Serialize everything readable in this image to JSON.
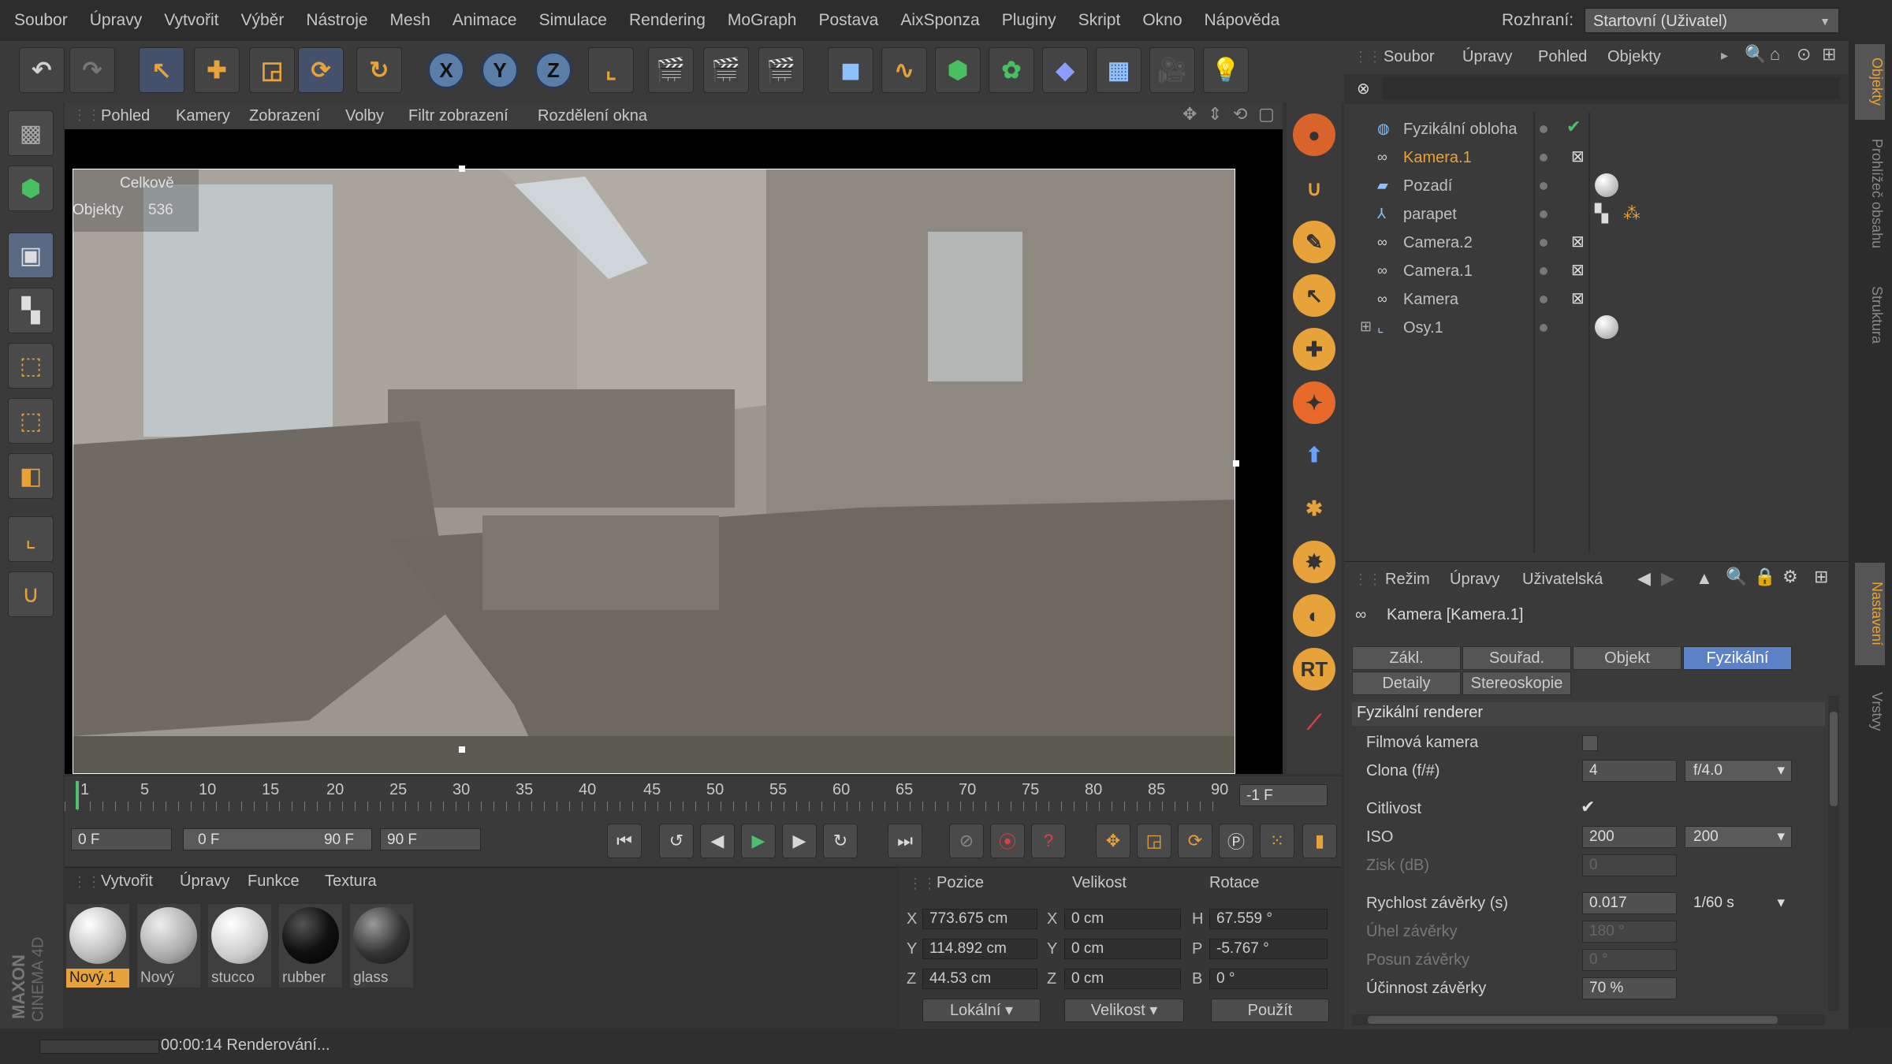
{
  "menubar": {
    "items": [
      "Soubor",
      "Úpravy",
      "Vytvořit",
      "Výběr",
      "Nástroje",
      "Mesh",
      "Animace",
      "Simulace",
      "Rendering",
      "MoGraph",
      "Postava",
      "AixSponza",
      "Pluginy",
      "Skript",
      "Okno",
      "Nápověda"
    ],
    "layout_label": "Rozhraní:",
    "layout_value": "Startovní (Uživatel)"
  },
  "toolbar": {
    "axis_x": "X",
    "axis_y": "Y",
    "axis_z": "Z"
  },
  "viewport": {
    "menu": [
      "Pohled",
      "Kamery",
      "Zobrazení",
      "Volby",
      "Filtr zobrazení",
      "Rozdělení okna"
    ],
    "hud_total": "Celkově",
    "hud_objects_label": "Objekty",
    "hud_objects_value": "536"
  },
  "rightbar": {
    "rt_label": "RT"
  },
  "timeline": {
    "ticks": [
      "1",
      "5",
      "10",
      "15",
      "20",
      "25",
      "30",
      "35",
      "40",
      "45",
      "50",
      "55",
      "60",
      "65",
      "70",
      "75",
      "80",
      "85",
      "90"
    ],
    "current_frame": "-1 F",
    "start_field": "0 F",
    "range_start": "0 F",
    "range_end": "90 F",
    "end_field": "90 F"
  },
  "materials": {
    "menu": [
      "Vytvořit",
      "Úpravy",
      "Funkce",
      "Textura"
    ],
    "items": [
      {
        "name": "Nový.1",
        "type": "white",
        "selected": true
      },
      {
        "name": "Nový",
        "type": "light",
        "selected": false
      },
      {
        "name": "stucco",
        "type": "white",
        "selected": false
      },
      {
        "name": "rubber",
        "type": "black",
        "selected": false
      },
      {
        "name": "glass",
        "type": "dark",
        "selected": false
      }
    ]
  },
  "coordinates": {
    "headers": {
      "position": "Pozice",
      "size": "Velikost",
      "rotation": "Rotace"
    },
    "rows": [
      {
        "pl": "X",
        "pv": "773.675 cm",
        "sl": "X",
        "sv": "0 cm",
        "rl": "H",
        "rv": "67.559 °"
      },
      {
        "pl": "Y",
        "pv": "114.892 cm",
        "sl": "Y",
        "sv": "0 cm",
        "rl": "P",
        "rv": "-5.767 °"
      },
      {
        "pl": "Z",
        "pv": "44.53 cm",
        "sl": "Z",
        "sv": "0 cm",
        "rl": "B",
        "rv": "0 °"
      }
    ],
    "mode_select": "Lokální",
    "size_select": "Velikost",
    "apply_button": "Použít"
  },
  "status": {
    "text": "00:00:14 Renderování..."
  },
  "objects": {
    "menu": [
      "Soubor",
      "Úpravy",
      "Pohled",
      "Objekty"
    ],
    "items": [
      {
        "name": "Fyzikální obloha",
        "icon": "sky-icon",
        "active": false
      },
      {
        "name": "Kamera.1",
        "icon": "camera-icon",
        "active": true
      },
      {
        "name": "Pozadí",
        "icon": "background-icon",
        "active": false
      },
      {
        "name": "parapet",
        "icon": "null-icon",
        "active": false
      },
      {
        "name": "Camera.2",
        "icon": "camera-icon",
        "active": false
      },
      {
        "name": "Camera.1",
        "icon": "camera-icon",
        "active": false
      },
      {
        "name": "Kamera",
        "icon": "camera-icon",
        "active": false
      },
      {
        "name": "Osy.1",
        "icon": "null-icon",
        "active": false
      }
    ]
  },
  "attributes": {
    "menu": [
      "Režim",
      "Úpravy",
      "Uživatelská"
    ],
    "object_title": "Kamera [Kamera.1]",
    "tabs_row1": [
      "Zákl.",
      "Souřad.",
      "Objekt",
      "Fyzikální"
    ],
    "tabs_row2": [
      "Detaily",
      "Stereoskopie"
    ],
    "active_tab": "Fyzikální",
    "section": "Fyzikální renderer",
    "props": {
      "film_camera": "Filmová kamera",
      "aperture": "Clona (f/#)",
      "aperture_value": "4",
      "aperture_preset": "f/4.0",
      "sensitivity": "Citlivost",
      "iso": "ISO",
      "iso_value": "200",
      "iso_preset": "200",
      "gain": "Zisk (dB)",
      "gain_value": "0",
      "shutter_speed": "Rychlost závěrky (s)",
      "shutter_speed_value": "0.017",
      "shutter_speed_preset": "1/60 s",
      "shutter_angle": "Úhel závěrky",
      "shutter_angle_value": "180 °",
      "shutter_offset": "Posun závěrky",
      "shutter_offset_value": "0 °",
      "shutter_efficiency": "Účinnost závěrky",
      "shutter_efficiency_value": "70 %"
    }
  },
  "side_tabs": {
    "objects": "Objekty",
    "browser": "Prohlížeč obsahu",
    "structure": "Struktura",
    "attributes": "Nastavení",
    "layers": "Vrstvy"
  },
  "brand": {
    "maxon": "MAXON",
    "cinema": "CINEMA 4D"
  },
  "colors": {
    "accent": "#e8a23a",
    "active_tab": "#5b82c7",
    "selected_object": "#e8a23a"
  }
}
